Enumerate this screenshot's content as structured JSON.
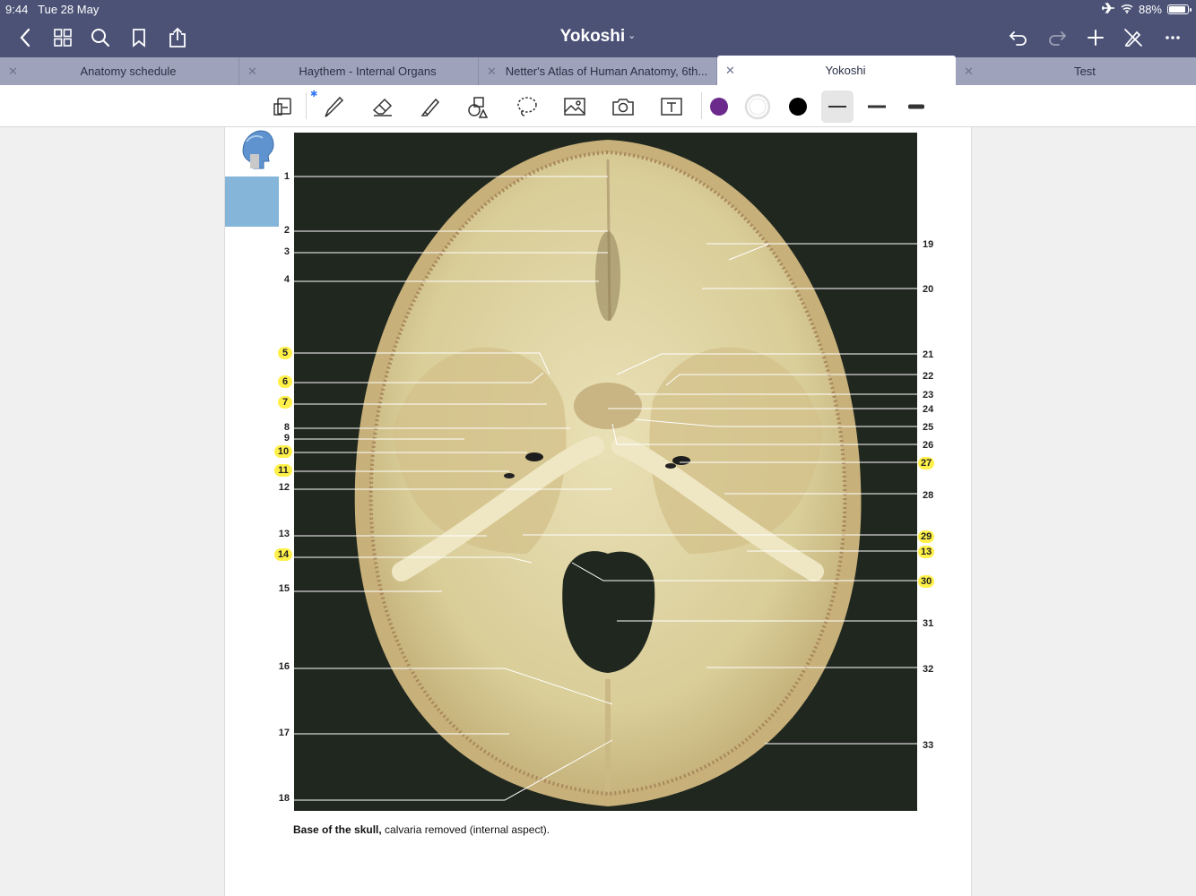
{
  "status_bar": {
    "time": "9:44",
    "date": "Tue 28 May",
    "battery": "88%"
  },
  "nav": {
    "title": "Yokoshi",
    "chevron": "⌄"
  },
  "tabs": [
    {
      "label": "Anatomy schedule",
      "active": false
    },
    {
      "label": "Haythem - Internal Organs",
      "active": false
    },
    {
      "label": "Netter's Atlas of Human Anatomy, 6th...",
      "active": true,
      "mark": ""
    },
    {
      "label": "Yokoshi",
      "active": true
    },
    {
      "label": "Test",
      "active": false
    }
  ],
  "toolbar": {
    "colors": {
      "purple": "#6c2a8c",
      "white": "#ffffff",
      "black": "#000000"
    },
    "tools": [
      "page-layout-icon",
      "pen-icon",
      "eraser-icon",
      "highlighter-icon",
      "shapes-icon",
      "lasso-icon",
      "image-icon",
      "camera-icon",
      "text-icon"
    ]
  },
  "figure": {
    "caption_bold": "Base of the skull,",
    "caption_rest": " calvaria removed (internal aspect).",
    "labels_left": [
      "1",
      "2",
      "3",
      "4",
      "5",
      "6",
      "7",
      "8",
      "9",
      "10",
      "11",
      "12",
      "13",
      "14",
      "15",
      "16",
      "17",
      "18"
    ],
    "labels_right": [
      "19",
      "20",
      "21",
      "22",
      "23",
      "24",
      "25",
      "26",
      "27",
      "28",
      "29",
      "13",
      "30",
      "31",
      "32",
      "33"
    ],
    "highlighted_left": [
      "5",
      "6",
      "7",
      "10",
      "11",
      "14"
    ],
    "highlighted_right": [
      "27",
      "29",
      "13",
      "30"
    ]
  }
}
